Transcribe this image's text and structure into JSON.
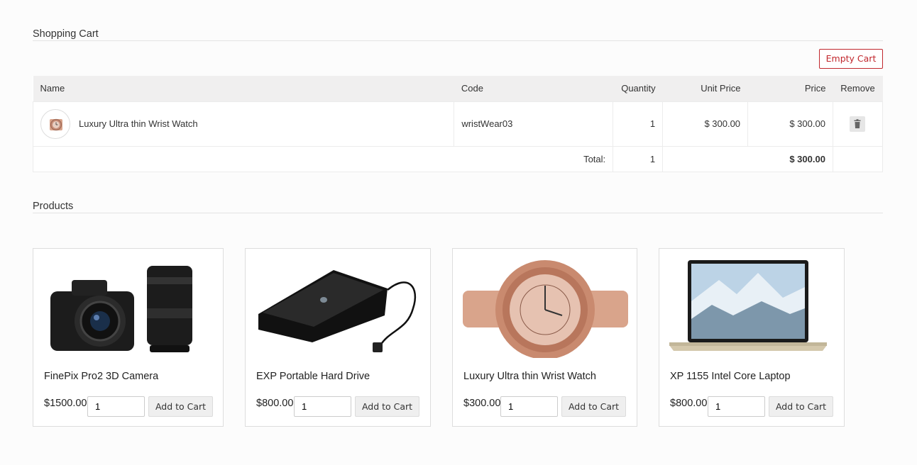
{
  "cart": {
    "heading": "Shopping Cart",
    "empty_label": "Empty Cart",
    "columns": [
      "Name",
      "Code",
      "Quantity",
      "Unit Price",
      "Price",
      "Remove"
    ],
    "items": [
      {
        "name": "Luxury Ultra thin Wrist Watch",
        "code": "wristWear03",
        "quantity": "1",
        "unit_price": "$ 300.00",
        "price": "$ 300.00",
        "thumb_icon": "watch-thumbnail"
      }
    ],
    "total_label": "Total:",
    "total_quantity": "1",
    "total_price": "$ 300.00"
  },
  "products": {
    "heading": "Products",
    "add_label": "Add to Cart",
    "items": [
      {
        "name": "FinePix Pro2 3D Camera",
        "price": "$1500.00",
        "qty": "1",
        "image": "camera-image"
      },
      {
        "name": "EXP Portable Hard Drive",
        "price": "$800.00",
        "qty": "1",
        "image": "hard-drive-image"
      },
      {
        "name": "Luxury Ultra thin Wrist Watch",
        "price": "$300.00",
        "qty": "1",
        "image": "watch-image"
      },
      {
        "name": "XP 1155 Intel Core Laptop",
        "price": "$800.00",
        "qty": "1",
        "image": "laptop-image"
      }
    ]
  },
  "colors": {
    "accent_red": "#c1272d",
    "header_bg": "#f0efef"
  }
}
